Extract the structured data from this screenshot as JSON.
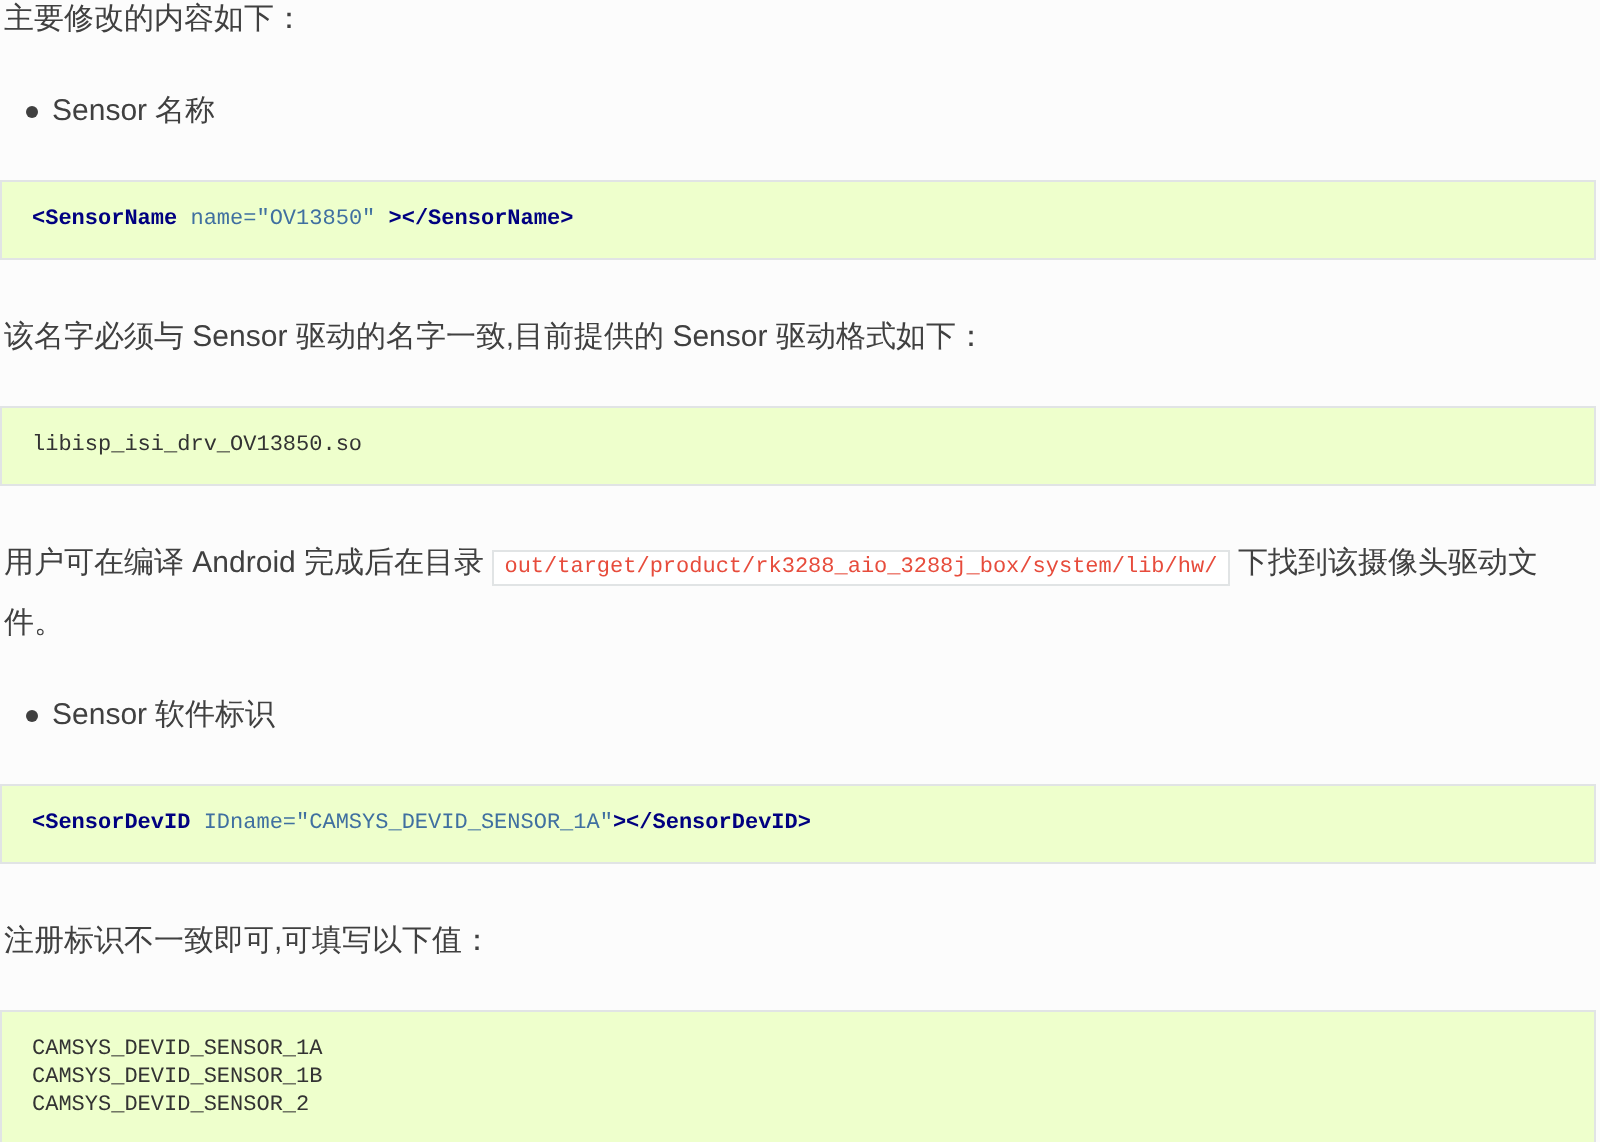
{
  "blocks": [
    {
      "kind": "paragraph",
      "segments": [
        {
          "kind": "text",
          "text": "主要修改的内容如下："
        }
      ]
    },
    {
      "kind": "bullet",
      "text": "Sensor 名称"
    },
    {
      "kind": "code",
      "lines": [
        [
          {
            "kind": "tag",
            "text": "<SensorName"
          },
          {
            "kind": "attr",
            "text": " name=\"OV13850\""
          },
          {
            "kind": "tag",
            "text": " ></SensorName>"
          }
        ]
      ]
    },
    {
      "kind": "paragraph",
      "segments": [
        {
          "kind": "text",
          "text": "该名字必须与 Sensor 驱动的名字一致,目前提供的 Sensor 驱动格式如下："
        }
      ]
    },
    {
      "kind": "code",
      "lines": [
        [
          {
            "kind": "plain",
            "text": "libisp_isi_drv_OV13850.so"
          }
        ]
      ]
    },
    {
      "kind": "paragraph",
      "segments": [
        {
          "kind": "text",
          "text": "用户可在编译 Android 完成后在目录 "
        },
        {
          "kind": "code",
          "text": "out/target/product/rk3288_aio_3288j_box/system/lib/hw/"
        },
        {
          "kind": "text",
          "text": " 下找到该摄像头驱动文件。"
        }
      ]
    },
    {
      "kind": "bullet",
      "text": "Sensor 软件标识"
    },
    {
      "kind": "code",
      "lines": [
        [
          {
            "kind": "tag",
            "text": "<SensorDevID"
          },
          {
            "kind": "attr",
            "text": " IDname=\"CAMSYS_DEVID_SENSOR_1A\""
          },
          {
            "kind": "tag",
            "text": "></SensorDevID>"
          }
        ]
      ]
    },
    {
      "kind": "paragraph",
      "segments": [
        {
          "kind": "text",
          "text": "注册标识不一致即可,可填写以下值："
        }
      ]
    },
    {
      "kind": "code",
      "lines": [
        [
          {
            "kind": "plain",
            "text": "CAMSYS_DEVID_SENSOR_1A"
          }
        ],
        [
          {
            "kind": "plain",
            "text": "CAMSYS_DEVID_SENSOR_1B"
          }
        ],
        [
          {
            "kind": "plain",
            "text": "CAMSYS_DEVID_SENSOR_2"
          }
        ]
      ]
    }
  ]
}
